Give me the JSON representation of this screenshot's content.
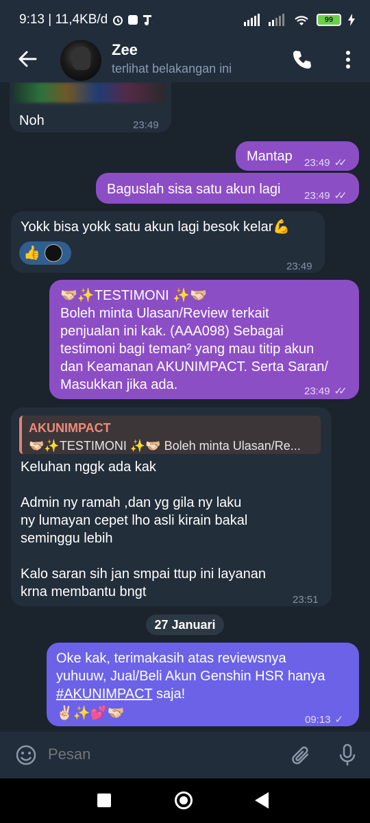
{
  "status_bar": {
    "time_speed": "9:13 | 11,4KB/d",
    "battery": "99"
  },
  "header": {
    "name": "Zee",
    "status": "terlihat belakangan ini"
  },
  "messages": [
    {
      "text": "Noh",
      "time": "23:49"
    },
    {
      "text": "Mantap",
      "time": "23:49"
    },
    {
      "text": "Baguslah sisa satu akun lagi",
      "time": "23:49"
    },
    {
      "text": "Yokk bisa yokk satu akun lagi besok kelar💪",
      "time": "23:49",
      "reaction": "👍"
    },
    {
      "text": "🫱🏻‍🫲🏼✨TESTIMONI ✨🫱🏻‍🫲🏼\nBoleh minta Ulasan/Review terkait\npenjualan ini kak. (AAA098) Sebagai\ntestimoni bagi teman² yang mau titip akun\ndan Keamanan AKUNIMPACT. Serta Saran/\nMasukkan jika ada.",
      "time": "23:49"
    },
    {
      "reply_name": "AKUNIMPACT",
      "reply_text": "🫱🏻‍🫲🏼✨TESTIMONI ✨🫱🏻‍🫲🏼 Boleh minta Ulasan/Re...",
      "text": "Keluhan nggk ada kak\n\nAdmin ny ramah ,dan yg gila ny laku\nny lumayan cepet lho asli kirain bakal\nseminggu lebih\n\nKalo saran sih jan smpai ttup ini layanan\nkrna membantu bngt",
      "time": "23:51"
    },
    {
      "text_before": "Oke kak, terimakasih atas reviewsnya\nyuhuuw, Jual/Beli Akun Genshin HSR hanya\n",
      "hashtag": "#AKUNIMPACT",
      "text_after": " saja!",
      "emoji_line": "✌🏻✨💕🫱🏻‍🫲🏼",
      "time": "09:13"
    }
  ],
  "date_chip": "27 Januari",
  "input": {
    "placeholder": "Pesan"
  },
  "colors": {
    "incoming": "#232e3b",
    "outgoing": "#8c4ec5",
    "outgoing_latest": "#6b62e8",
    "reply_accent": "#e08478"
  }
}
